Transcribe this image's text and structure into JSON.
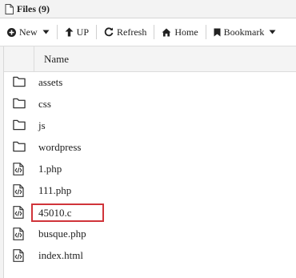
{
  "title": "Files (9)",
  "toolbar": {
    "new_label": "New",
    "up_label": "UP",
    "refresh_label": "Refresh",
    "home_label": "Home",
    "bookmark_label": "Bookmark"
  },
  "columns": {
    "name": "Name"
  },
  "files": [
    {
      "name": "assets",
      "icon": "folder-icon"
    },
    {
      "name": "css",
      "icon": "folder-icon"
    },
    {
      "name": "js",
      "icon": "folder-icon"
    },
    {
      "name": "wordpress",
      "icon": "folder-icon"
    },
    {
      "name": "1.php",
      "icon": "code-file-icon"
    },
    {
      "name": "111.php",
      "icon": "code-file-icon"
    },
    {
      "name": "45010.c",
      "icon": "code-file-icon"
    },
    {
      "name": "busque.php",
      "icon": "code-file-icon"
    },
    {
      "name": "index.html",
      "icon": "code-file-icon"
    }
  ],
  "colors": {
    "rename_border": "#d0343a"
  }
}
